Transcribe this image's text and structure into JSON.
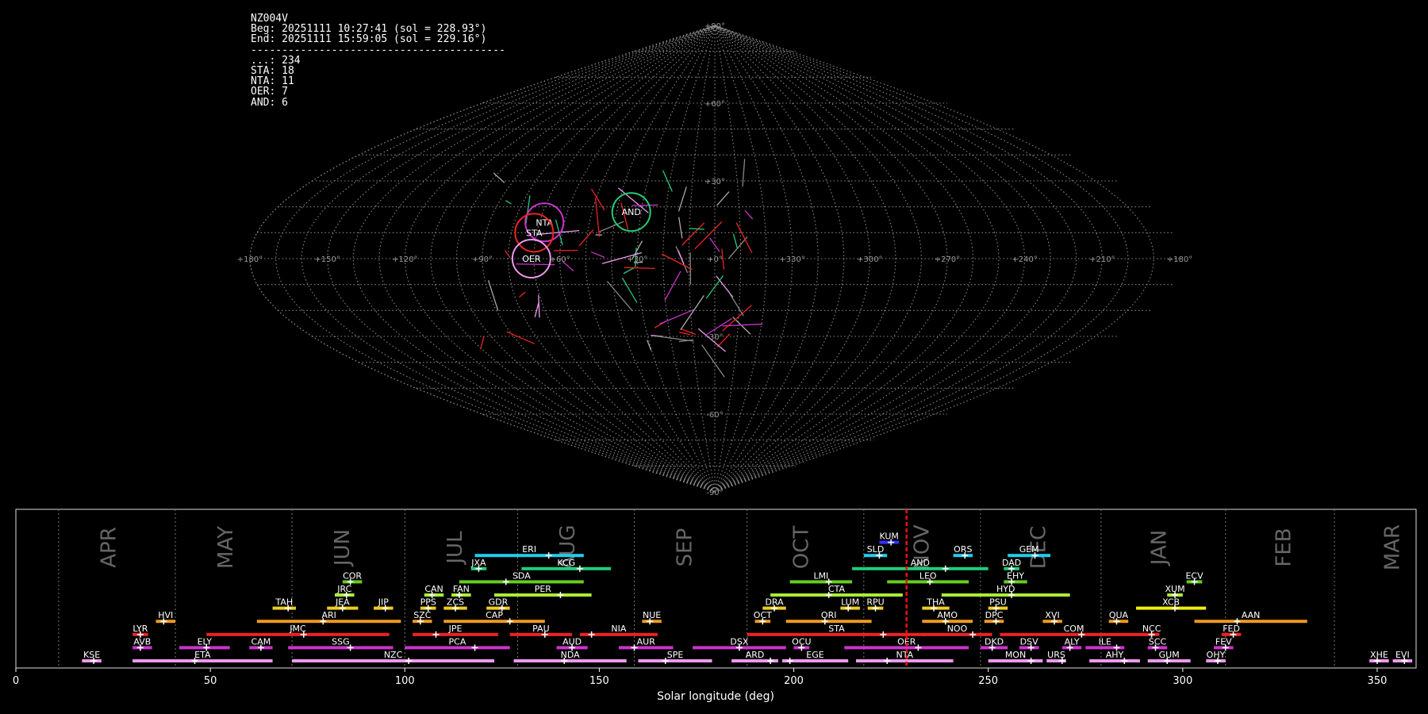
{
  "info_lines": [
    "NZ004V",
    "Beg: 20251111 10:27:41 (sol = 228.93°)",
    "End: 20251111 15:59:05 (sol = 229.16°)",
    "-----------------------------------------",
    "...: 234",
    "STA: 18",
    "NTA: 11",
    "OER: 7",
    "AND: 6"
  ],
  "chart_data": [
    {
      "type": "scatter",
      "description_kind": "radiant sky map (sinusoidal projection, Sun-centered longitude)",
      "lon_tick_labels": [
        "+180°",
        "+150°",
        "+120°",
        "+90°",
        "+60°",
        "+30°",
        "+0°",
        "+330°",
        "+300°",
        "+270°",
        "+240°",
        "+210°",
        "+180°"
      ],
      "lat_tick_labels": [
        "+90°",
        "+60°",
        "+30°",
        "-30°",
        "-60°",
        "-90°"
      ],
      "showers": [
        {
          "code": "NTA",
          "lon": 68,
          "lat": 14,
          "color": "#cc33cc"
        },
        {
          "code": "STA",
          "lon": 71,
          "lat": 10,
          "color": "#ee2222"
        },
        {
          "code": "OER",
          "lon": 71,
          "lat": 0,
          "color": "#ee99ee"
        },
        {
          "code": "AND",
          "lon": 34,
          "lat": 18,
          "color": "#22cc77"
        }
      ],
      "grid": true
    },
    {
      "type": "bar",
      "description_kind": "meteor shower activity timeline",
      "xlabel": "Solar longitude (deg)",
      "xlim": [
        0,
        360
      ],
      "x_ticks": [
        "0",
        "50",
        "100",
        "150",
        "200",
        "250",
        "300",
        "350"
      ],
      "current_sol": 229.0,
      "months": [
        {
          "label": "APR",
          "sol": 24
        },
        {
          "label": "MAY",
          "sol": 54
        },
        {
          "label": "JUN",
          "sol": 84
        },
        {
          "label": "JUL",
          "sol": 113
        },
        {
          "label": "AUG",
          "sol": 142
        },
        {
          "label": "SEP",
          "sol": 172
        },
        {
          "label": "OCT",
          "sol": 202
        },
        {
          "label": "NOV",
          "sol": 233
        },
        {
          "label": "DEC",
          "sol": 263
        },
        {
          "label": "JAN",
          "sol": 294
        },
        {
          "label": "FEB",
          "sol": 326
        },
        {
          "label": "MAR",
          "sol": 354
        }
      ],
      "month_dividers": [
        11,
        41,
        71,
        100,
        129,
        159,
        188,
        218,
        248,
        279,
        311,
        339
      ],
      "showers": [
        {
          "code": "KUM",
          "start": 222,
          "end": 227,
          "peak": 225,
          "row": 10,
          "color": "#3333ff"
        },
        {
          "code": "ERI",
          "start": 118,
          "end": 146,
          "peak": 137,
          "row": 9,
          "color": "#22ccee"
        },
        {
          "code": "SLD",
          "start": 218,
          "end": 224,
          "peak": 222,
          "row": 9,
          "color": "#22ccee"
        },
        {
          "code": "ORS",
          "start": 241,
          "end": 246,
          "peak": 244,
          "row": 9,
          "color": "#22ccee"
        },
        {
          "code": "GEM",
          "start": 255,
          "end": 266,
          "peak": 262,
          "row": 9,
          "color": "#22ccee"
        },
        {
          "code": "JXA",
          "start": 117,
          "end": 121,
          "peak": 119,
          "row": 8,
          "color": "#22cc77"
        },
        {
          "code": "KCG",
          "start": 130,
          "end": 153,
          "peak": 145,
          "row": 8,
          "color": "#22cc77"
        },
        {
          "code": "AND",
          "start": 215,
          "end": 250,
          "peak": 239,
          "row": 8,
          "color": "#22cc77"
        },
        {
          "code": "DAD",
          "start": 254,
          "end": 258,
          "peak": 256,
          "row": 8,
          "color": "#22cc77"
        },
        {
          "code": "COR",
          "start": 84,
          "end": 89,
          "peak": 86,
          "row": 7,
          "color": "#66cc22"
        },
        {
          "code": "SDA",
          "start": 114,
          "end": 146,
          "peak": 126,
          "row": 7,
          "color": "#66cc22"
        },
        {
          "code": "LMI",
          "start": 199,
          "end": 215,
          "peak": 209,
          "row": 7,
          "color": "#66cc22"
        },
        {
          "code": "LEO",
          "start": 224,
          "end": 245,
          "peak": 235,
          "row": 7,
          "color": "#66cc22"
        },
        {
          "code": "EHY",
          "start": 254,
          "end": 260,
          "peak": 256,
          "row": 7,
          "color": "#66cc22"
        },
        {
          "code": "ECV",
          "start": 301,
          "end": 305,
          "peak": 303,
          "row": 7,
          "color": "#66cc22"
        },
        {
          "code": "JRC",
          "start": 82,
          "end": 87,
          "peak": 85,
          "row": 6,
          "color": "#aaee33"
        },
        {
          "code": "CAN",
          "start": 105,
          "end": 110,
          "peak": 107,
          "row": 6,
          "color": "#aaee33"
        },
        {
          "code": "FAN",
          "start": 112,
          "end": 117,
          "peak": 114,
          "row": 6,
          "color": "#aaee33"
        },
        {
          "code": "PER",
          "start": 123,
          "end": 148,
          "peak": 140,
          "row": 6,
          "color": "#aaee33"
        },
        {
          "code": "CTA",
          "start": 194,
          "end": 228,
          "peak": 209,
          "row": 6,
          "color": "#aaee33"
        },
        {
          "code": "HYD",
          "start": 238,
          "end": 271,
          "peak": 256,
          "row": 6,
          "color": "#aaee33"
        },
        {
          "code": "XUM",
          "start": 296,
          "end": 300,
          "peak": 298,
          "row": 6,
          "color": "#aaee33"
        },
        {
          "code": "TAH",
          "start": 66,
          "end": 72,
          "peak": 70,
          "row": 5,
          "color": "#eecc22"
        },
        {
          "code": "JEA",
          "start": 80,
          "end": 88,
          "peak": 84,
          "row": 5,
          "color": "#eecc22"
        },
        {
          "code": "JIP",
          "start": 92,
          "end": 97,
          "peak": 95,
          "row": 5,
          "color": "#eecc22"
        },
        {
          "code": "PPS",
          "start": 104,
          "end": 108,
          "peak": 106,
          "row": 5,
          "color": "#eecc22"
        },
        {
          "code": "ZCS",
          "start": 110,
          "end": 116,
          "peak": 113,
          "row": 5,
          "color": "#eecc22"
        },
        {
          "code": "GDR",
          "start": 121,
          "end": 127,
          "peak": 125,
          "row": 5,
          "color": "#eecc22"
        },
        {
          "code": "DRA",
          "start": 192,
          "end": 198,
          "peak": 195,
          "row": 5,
          "color": "#eecc22"
        },
        {
          "code": "LUM",
          "start": 212,
          "end": 217,
          "peak": 214,
          "row": 5,
          "color": "#eecc22"
        },
        {
          "code": "RPU",
          "start": 219,
          "end": 223,
          "peak": 221,
          "row": 5,
          "color": "#eecc22"
        },
        {
          "code": "THA",
          "start": 233,
          "end": 240,
          "peak": 236,
          "row": 5,
          "color": "#eecc22"
        },
        {
          "code": "PSU",
          "start": 250,
          "end": 255,
          "peak": 252,
          "row": 5,
          "color": "#eecc22"
        },
        {
          "code": "XCB",
          "start": 288,
          "end": 306,
          "peak": 298,
          "row": 5,
          "color": "#eeee11"
        },
        {
          "code": "HVI",
          "start": 36,
          "end": 41,
          "peak": 38,
          "row": 4,
          "color": "#ee9922"
        },
        {
          "code": "ARI",
          "start": 62,
          "end": 99,
          "peak": 79,
          "row": 4,
          "color": "#ee9922"
        },
        {
          "code": "SZC",
          "start": 102,
          "end": 107,
          "peak": 104,
          "row": 4,
          "color": "#ee9922"
        },
        {
          "code": "CAP",
          "start": 110,
          "end": 136,
          "peak": 127,
          "row": 4,
          "color": "#ee9922"
        },
        {
          "code": "NUE",
          "start": 161,
          "end": 166,
          "peak": 163,
          "row": 4,
          "color": "#ee9922"
        },
        {
          "code": "OCT",
          "start": 190,
          "end": 194,
          "peak": 192,
          "row": 4,
          "color": "#ee9922"
        },
        {
          "code": "ORI",
          "start": 198,
          "end": 220,
          "peak": 208,
          "row": 4,
          "color": "#ee9922"
        },
        {
          "code": "AMO",
          "start": 233,
          "end": 246,
          "peak": 239,
          "row": 4,
          "color": "#ee9922"
        },
        {
          "code": "DPC",
          "start": 249,
          "end": 254,
          "peak": 252,
          "row": 4,
          "color": "#ee9922"
        },
        {
          "code": "XVI",
          "start": 264,
          "end": 269,
          "peak": 267,
          "row": 4,
          "color": "#ee9922"
        },
        {
          "code": "QUA",
          "start": 281,
          "end": 286,
          "peak": 283,
          "row": 4,
          "color": "#ee9922"
        },
        {
          "code": "AAN",
          "start": 303,
          "end": 332,
          "peak": 314,
          "row": 4,
          "color": "#ee9922"
        },
        {
          "code": "LYR",
          "start": 30,
          "end": 34,
          "peak": 32,
          "row": 3,
          "color": "#ee2222"
        },
        {
          "code": "JMC",
          "start": 49,
          "end": 96,
          "peak": 74,
          "row": 3,
          "color": "#ee2222"
        },
        {
          "code": "JPE",
          "start": 102,
          "end": 124,
          "peak": 108,
          "row": 3,
          "color": "#ee2222"
        },
        {
          "code": "PAU",
          "start": 127,
          "end": 143,
          "peak": 136,
          "row": 3,
          "color": "#ee2222"
        },
        {
          "code": "NIA",
          "start": 145,
          "end": 165,
          "peak": 148,
          "row": 3,
          "color": "#ee2222"
        },
        {
          "code": "STA",
          "start": 188,
          "end": 234,
          "peak": 223,
          "row": 3,
          "color": "#ee2222"
        },
        {
          "code": "NOO",
          "start": 233,
          "end": 251,
          "peak": 246,
          "row": 3,
          "color": "#ee2222"
        },
        {
          "code": "COM",
          "start": 253,
          "end": 291,
          "peak": 274,
          "row": 3,
          "color": "#ee2222"
        },
        {
          "code": "NCC",
          "start": 290,
          "end": 294,
          "peak": 292,
          "row": 3,
          "color": "#ee2222"
        },
        {
          "code": "FED",
          "start": 310,
          "end": 315,
          "peak": 313,
          "row": 3,
          "color": "#ee2222"
        },
        {
          "code": "AVB",
          "start": 30,
          "end": 35,
          "peak": 32,
          "row": 2,
          "color": "#cc33cc"
        },
        {
          "code": "ELY",
          "start": 42,
          "end": 55,
          "peak": 49,
          "row": 2,
          "color": "#cc33cc"
        },
        {
          "code": "CAM",
          "start": 60,
          "end": 66,
          "peak": 63,
          "row": 2,
          "color": "#cc33cc"
        },
        {
          "code": "SSG",
          "start": 70,
          "end": 97,
          "peak": 86,
          "row": 2,
          "color": "#cc33cc"
        },
        {
          "code": "PCA",
          "start": 100,
          "end": 127,
          "peak": 118,
          "row": 2,
          "color": "#cc33cc"
        },
        {
          "code": "AUD",
          "start": 139,
          "end": 147,
          "peak": 143,
          "row": 2,
          "color": "#cc33cc"
        },
        {
          "code": "AUR",
          "start": 155,
          "end": 169,
          "peak": 159,
          "row": 2,
          "color": "#cc33cc"
        },
        {
          "code": "DSX",
          "start": 174,
          "end": 198,
          "peak": 186,
          "row": 2,
          "color": "#cc33cc"
        },
        {
          "code": "OCU",
          "start": 200,
          "end": 204,
          "peak": 202,
          "row": 2,
          "color": "#cc33cc"
        },
        {
          "code": "OER",
          "start": 213,
          "end": 245,
          "peak": 232,
          "row": 2,
          "color": "#cc33cc"
        },
        {
          "code": "DKD",
          "start": 248,
          "end": 255,
          "peak": 251,
          "row": 2,
          "color": "#cc33cc"
        },
        {
          "code": "DSV",
          "start": 258,
          "end": 263,
          "peak": 261,
          "row": 2,
          "color": "#cc33cc"
        },
        {
          "code": "ALY",
          "start": 269,
          "end": 274,
          "peak": 271,
          "row": 2,
          "color": "#cc33cc"
        },
        {
          "code": "ILE",
          "start": 275,
          "end": 285,
          "peak": 283,
          "row": 2,
          "color": "#cc33cc"
        },
        {
          "code": "SCC",
          "start": 291,
          "end": 296,
          "peak": 293,
          "row": 2,
          "color": "#cc33cc"
        },
        {
          "code": "FEV",
          "start": 308,
          "end": 313,
          "peak": 311,
          "row": 2,
          "color": "#cc33cc"
        },
        {
          "code": "KSE",
          "start": 17,
          "end": 22,
          "peak": 20,
          "row": 1,
          "color": "#ee99ee"
        },
        {
          "code": "ETA",
          "start": 30,
          "end": 66,
          "peak": 46,
          "row": 1,
          "color": "#ee99ee"
        },
        {
          "code": "NZC",
          "start": 71,
          "end": 123,
          "peak": 101,
          "row": 1,
          "color": "#ee99ee"
        },
        {
          "code": "NDA",
          "start": 128,
          "end": 157,
          "peak": 141,
          "row": 1,
          "color": "#ee99ee"
        },
        {
          "code": "SPE",
          "start": 160,
          "end": 179,
          "peak": 167,
          "row": 1,
          "color": "#ee99ee"
        },
        {
          "code": "ARD",
          "start": 184,
          "end": 196,
          "peak": 194,
          "row": 1,
          "color": "#ee99ee"
        },
        {
          "code": "EGE",
          "start": 197,
          "end": 214,
          "peak": 199,
          "row": 1,
          "color": "#ee99ee"
        },
        {
          "code": "NTA",
          "start": 216,
          "end": 241,
          "peak": 224,
          "row": 1,
          "color": "#ee99ee"
        },
        {
          "code": "MON",
          "start": 250,
          "end": 264,
          "peak": 261,
          "row": 1,
          "color": "#ee99ee"
        },
        {
          "code": "URS",
          "start": 265,
          "end": 270,
          "peak": 269,
          "row": 1,
          "color": "#ee99ee"
        },
        {
          "code": "AHY",
          "start": 276,
          "end": 289,
          "peak": 285,
          "row": 1,
          "color": "#ee99ee"
        },
        {
          "code": "GUM",
          "start": 291,
          "end": 302,
          "peak": 296,
          "row": 1,
          "color": "#ee99ee"
        },
        {
          "code": "OHY",
          "start": 306,
          "end": 311,
          "peak": 309,
          "row": 1,
          "color": "#ee99ee"
        },
        {
          "code": "XHE",
          "start": 348,
          "end": 353,
          "peak": 350,
          "row": 1,
          "color": "#ee99ee"
        },
        {
          "code": "EVI",
          "start": 354,
          "end": 359,
          "peak": 357,
          "row": 1,
          "color": "#ee99ee"
        }
      ]
    }
  ]
}
